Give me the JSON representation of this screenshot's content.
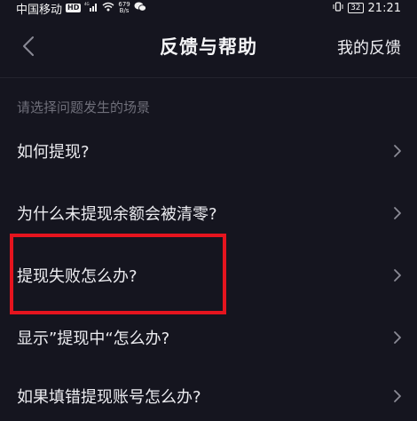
{
  "status_bar": {
    "carrier": "中国移动",
    "hd": "HD",
    "signal_sup": "4G",
    "net_speed_value": "679",
    "net_speed_unit": "B/s",
    "battery": "32",
    "time": "21:21"
  },
  "nav": {
    "title": "反馈与帮助",
    "action": "我的反馈"
  },
  "section": {
    "label": "请选择问题发生的场景"
  },
  "items": [
    {
      "label": "如何提现?"
    },
    {
      "label": "为什么未提现余额会被清零?"
    },
    {
      "label": "提现失败怎么办?"
    },
    {
      "label": "显示”提现中“怎么办?"
    },
    {
      "label": "如果填错提现账号怎么办?"
    }
  ],
  "colors": {
    "background": "#15151f",
    "highlight": "#e5141e",
    "text_primary": "#ececf0",
    "text_secondary": "#6f6f7a"
  },
  "icons": {
    "back": "back-arrow-icon",
    "chevron": "chevron-right-icon",
    "wifi": "wifi-icon",
    "signal": "signal-icon",
    "chat": "wechat-icon",
    "vibrate": "vibrate-icon"
  }
}
